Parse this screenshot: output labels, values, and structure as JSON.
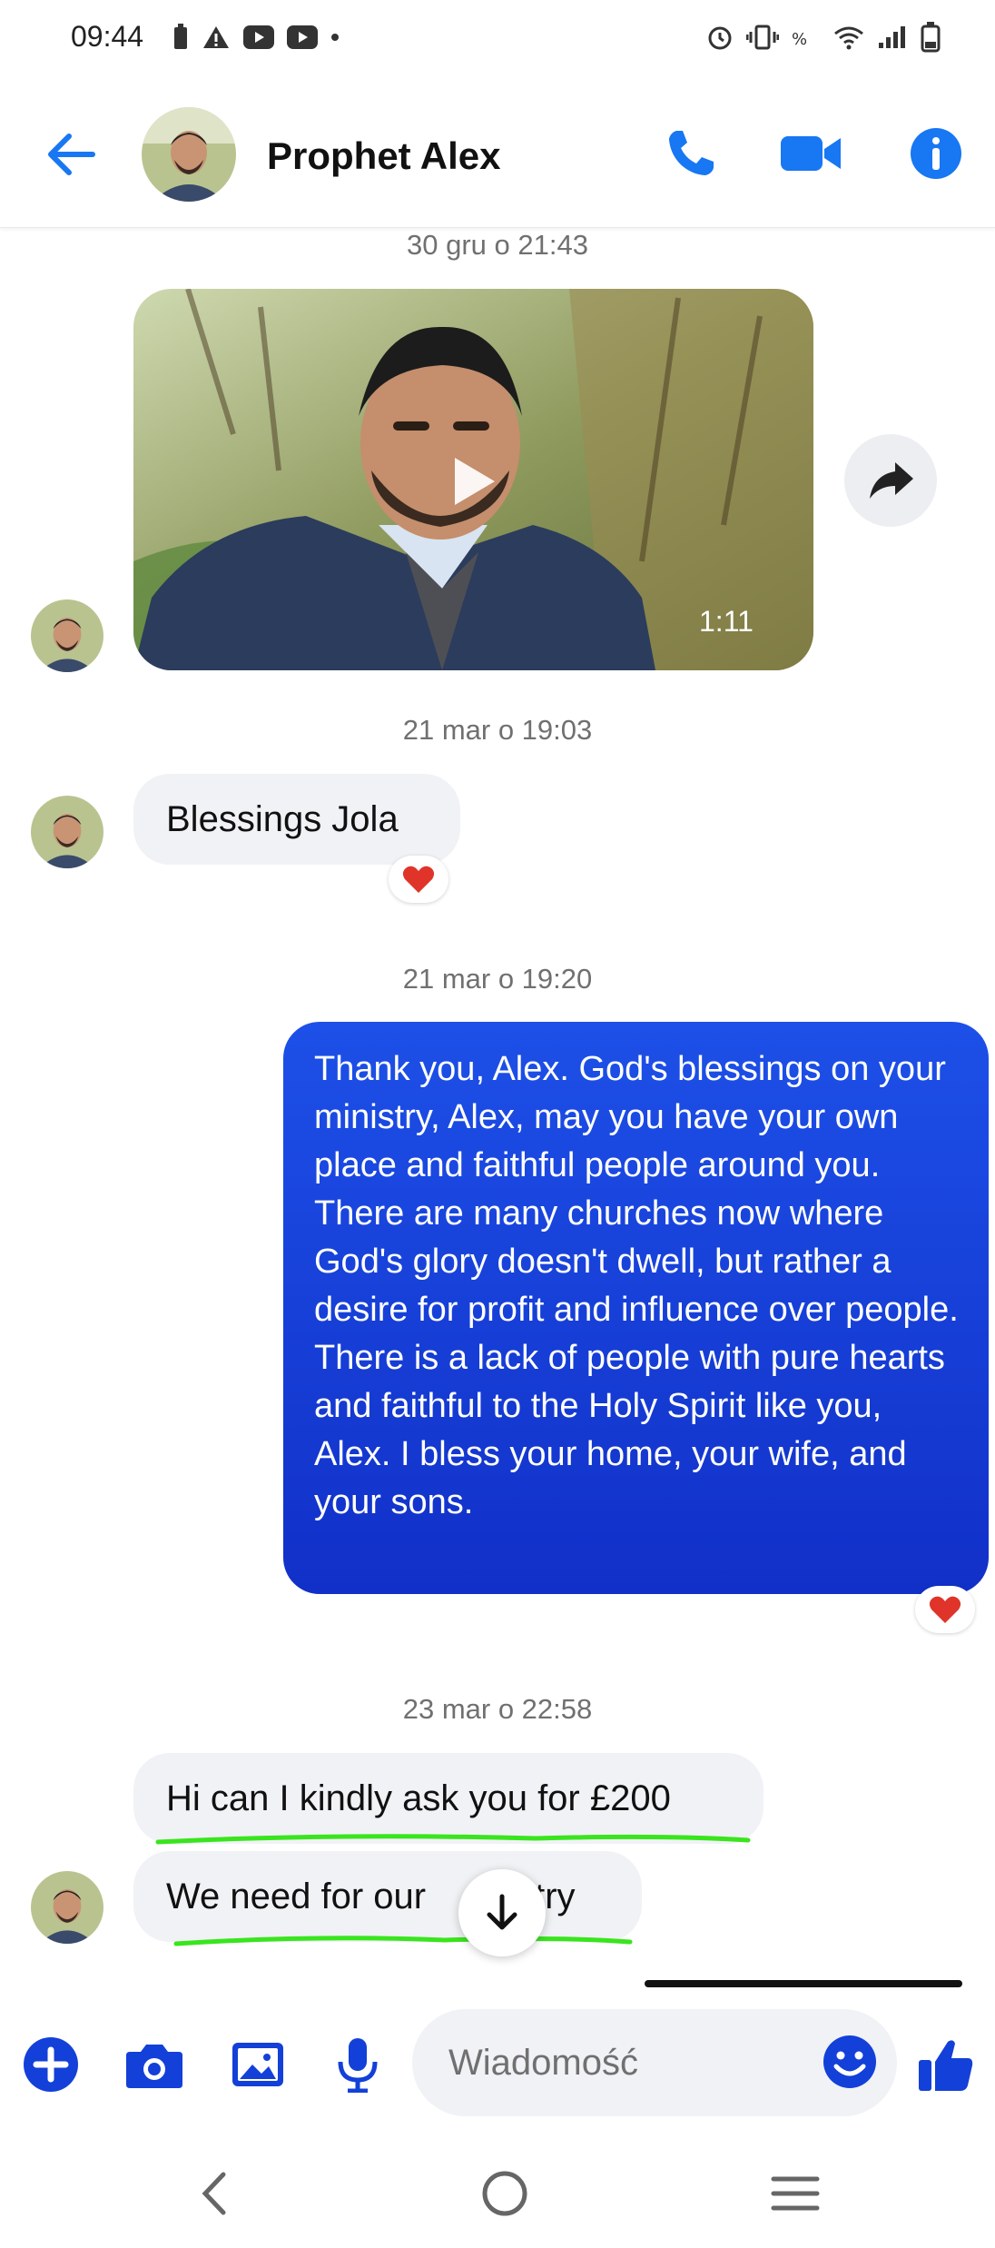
{
  "status_bar": {
    "time": "09:44"
  },
  "header": {
    "contact_name": "Prophet Alex"
  },
  "conversation": {
    "timestamps": [
      "30 gru o 21:43",
      "21 mar o 19:03",
      "21 mar o 19:20",
      "23 mar o 22:58"
    ],
    "video": {
      "duration": "1:11"
    },
    "messages": [
      {
        "direction": "incoming",
        "text": "Blessings Jola",
        "reaction": "heart"
      },
      {
        "direction": "outgoing",
        "text": "Thank you, Alex. God's blessings on your ministry, Alex, may you have your own place and faithful people around you. There are many churches now where God's glory doesn't dwell, but rather a desire for profit and influence over people. There is a lack of people with pure hearts and faithful to the Holy Spirit like you, Alex. I bless your home, your wife, and your sons.",
        "reaction": "heart"
      },
      {
        "direction": "incoming",
        "text": "Hi can I kindly ask you for £200"
      },
      {
        "direction": "incoming",
        "text_before": "We need for our",
        "text_after": "stry"
      }
    ]
  },
  "composer": {
    "placeholder": "Wiadomość"
  },
  "colors": {
    "accent": "#1877f2",
    "outgoing_bubble": "#1340d8",
    "annotation": "#39e51d"
  }
}
